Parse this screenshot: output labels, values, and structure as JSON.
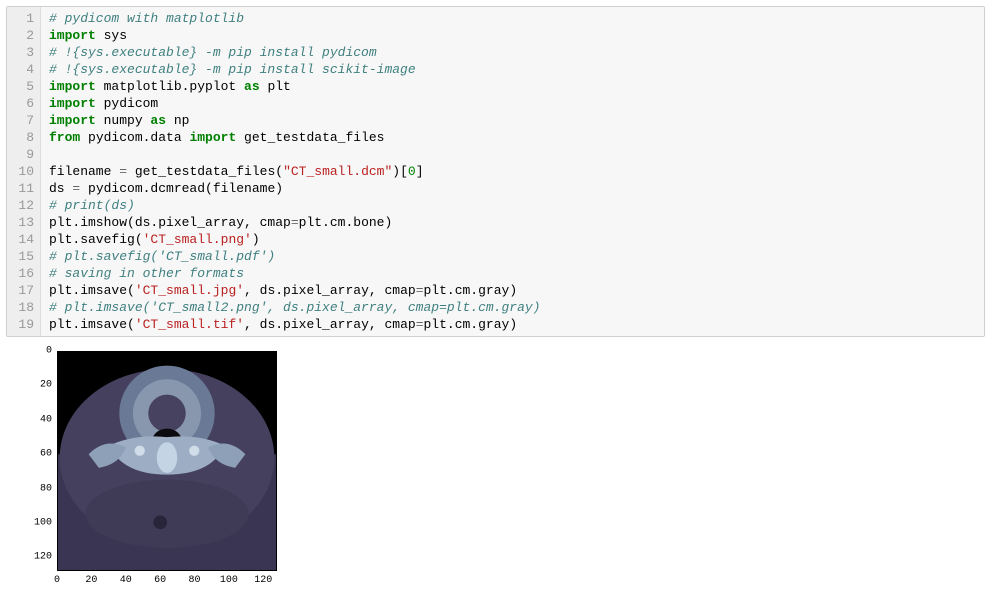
{
  "code": {
    "line_count": 19,
    "lines": [
      [
        {
          "t": "# pydicom with matplotlib",
          "c": "c-comment"
        }
      ],
      [
        {
          "t": "import",
          "c": "c-keyword"
        },
        {
          "t": " sys",
          "c": "c-plain"
        }
      ],
      [
        {
          "t": "# !{sys.executable} -m pip install pydicom",
          "c": "c-comment"
        }
      ],
      [
        {
          "t": "# !{sys.executable} -m pip install scikit-image",
          "c": "c-comment"
        }
      ],
      [
        {
          "t": "import",
          "c": "c-keyword"
        },
        {
          "t": " matplotlib.pyplot ",
          "c": "c-plain"
        },
        {
          "t": "as",
          "c": "c-keyword"
        },
        {
          "t": " plt",
          "c": "c-plain"
        }
      ],
      [
        {
          "t": "import",
          "c": "c-keyword"
        },
        {
          "t": " pydicom",
          "c": "c-plain"
        }
      ],
      [
        {
          "t": "import",
          "c": "c-keyword"
        },
        {
          "t": " numpy ",
          "c": "c-plain"
        },
        {
          "t": "as",
          "c": "c-keyword"
        },
        {
          "t": " np",
          "c": "c-plain"
        }
      ],
      [
        {
          "t": "from",
          "c": "c-keyword"
        },
        {
          "t": " pydicom.data ",
          "c": "c-plain"
        },
        {
          "t": "import",
          "c": "c-keyword"
        },
        {
          "t": " get_testdata_files",
          "c": "c-plain"
        }
      ],
      [],
      [
        {
          "t": "filename ",
          "c": "c-plain"
        },
        {
          "t": "=",
          "c": "c-op2"
        },
        {
          "t": " get_testdata_files(",
          "c": "c-plain"
        },
        {
          "t": "\"CT_small.dcm\"",
          "c": "c-string"
        },
        {
          "t": ")[",
          "c": "c-plain"
        },
        {
          "t": "0",
          "c": "c-number"
        },
        {
          "t": "]",
          "c": "c-plain"
        }
      ],
      [
        {
          "t": "ds ",
          "c": "c-plain"
        },
        {
          "t": "=",
          "c": "c-op2"
        },
        {
          "t": " pydicom.dcmread(filename)",
          "c": "c-plain"
        }
      ],
      [
        {
          "t": "# print(ds)",
          "c": "c-comment"
        }
      ],
      [
        {
          "t": "plt.imshow(ds.pixel_array, cmap",
          "c": "c-plain"
        },
        {
          "t": "=",
          "c": "c-op2"
        },
        {
          "t": "plt.cm.bone)",
          "c": "c-plain"
        }
      ],
      [
        {
          "t": "plt.savefig(",
          "c": "c-plain"
        },
        {
          "t": "'CT_small.png'",
          "c": "c-string"
        },
        {
          "t": ")",
          "c": "c-plain"
        }
      ],
      [
        {
          "t": "# plt.savefig('CT_small.pdf')",
          "c": "c-comment"
        }
      ],
      [
        {
          "t": "# saving in other formats",
          "c": "c-comment"
        }
      ],
      [
        {
          "t": "plt.imsave(",
          "c": "c-plain"
        },
        {
          "t": "'CT_small.jpg'",
          "c": "c-string"
        },
        {
          "t": ", ds.pixel_array, cmap",
          "c": "c-plain"
        },
        {
          "t": "=",
          "c": "c-op2"
        },
        {
          "t": "plt.cm.gray)",
          "c": "c-plain"
        }
      ],
      [
        {
          "t": "# plt.imsave('CT_small2.png', ds.pixel_array, cmap=plt.cm.gray)",
          "c": "c-comment"
        }
      ],
      [
        {
          "t": "plt.imsave(",
          "c": "c-plain"
        },
        {
          "t": "'CT_small.tif'",
          "c": "c-string"
        },
        {
          "t": ", ds.pixel_array, cmap",
          "c": "c-plain"
        },
        {
          "t": "=",
          "c": "c-op2"
        },
        {
          "t": "plt.cm.gray)",
          "c": "c-plain"
        }
      ]
    ]
  },
  "chart_data": {
    "type": "image",
    "description": "CT medical scan slice rendered with bone colormap",
    "xlim": [
      0,
      128
    ],
    "ylim": [
      0,
      128
    ],
    "xticks": [
      0,
      20,
      40,
      60,
      80,
      100,
      120
    ],
    "yticks": [
      0,
      20,
      40,
      60,
      80,
      100,
      120
    ],
    "colormap": "bone"
  }
}
